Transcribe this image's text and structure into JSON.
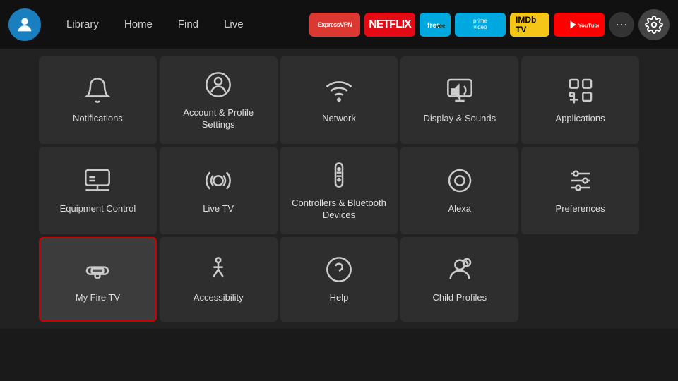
{
  "nav": {
    "links": [
      "Library",
      "Home",
      "Find",
      "Live"
    ],
    "apps": [
      {
        "name": "expressvpn",
        "label": "ExpressVPN",
        "class": "expressvpn"
      },
      {
        "name": "netflix",
        "label": "NETFLIX",
        "class": "netflix"
      },
      {
        "name": "freevee",
        "label": "▶",
        "class": "freevee"
      },
      {
        "name": "primevideo",
        "label": "prime video",
        "class": "primevideo"
      },
      {
        "name": "imdb",
        "label": "IMDb TV",
        "class": "imdb"
      },
      {
        "name": "youtube",
        "label": "▶ YouTube",
        "class": "youtube"
      }
    ]
  },
  "tiles": [
    {
      "id": "notifications",
      "label": "Notifications",
      "icon": "bell",
      "selected": false
    },
    {
      "id": "account-profile",
      "label": "Account & Profile Settings",
      "icon": "person-circle",
      "selected": false
    },
    {
      "id": "network",
      "label": "Network",
      "icon": "wifi",
      "selected": false
    },
    {
      "id": "display-sounds",
      "label": "Display & Sounds",
      "icon": "display-sound",
      "selected": false
    },
    {
      "id": "applications",
      "label": "Applications",
      "icon": "apps-grid",
      "selected": false
    },
    {
      "id": "equipment-control",
      "label": "Equipment Control",
      "icon": "monitor",
      "selected": false
    },
    {
      "id": "live-tv",
      "label": "Live TV",
      "icon": "antenna",
      "selected": false
    },
    {
      "id": "controllers-bluetooth",
      "label": "Controllers & Bluetooth Devices",
      "icon": "remote",
      "selected": false
    },
    {
      "id": "alexa",
      "label": "Alexa",
      "icon": "alexa-ring",
      "selected": false
    },
    {
      "id": "preferences",
      "label": "Preferences",
      "icon": "sliders",
      "selected": false
    },
    {
      "id": "my-fire-tv",
      "label": "My Fire TV",
      "icon": "fire-stick",
      "selected": true
    },
    {
      "id": "accessibility",
      "label": "Accessibility",
      "icon": "accessibility",
      "selected": false
    },
    {
      "id": "help",
      "label": "Help",
      "icon": "help-circle",
      "selected": false
    },
    {
      "id": "child-profiles",
      "label": "Child Profiles",
      "icon": "child-profile",
      "selected": false
    }
  ]
}
